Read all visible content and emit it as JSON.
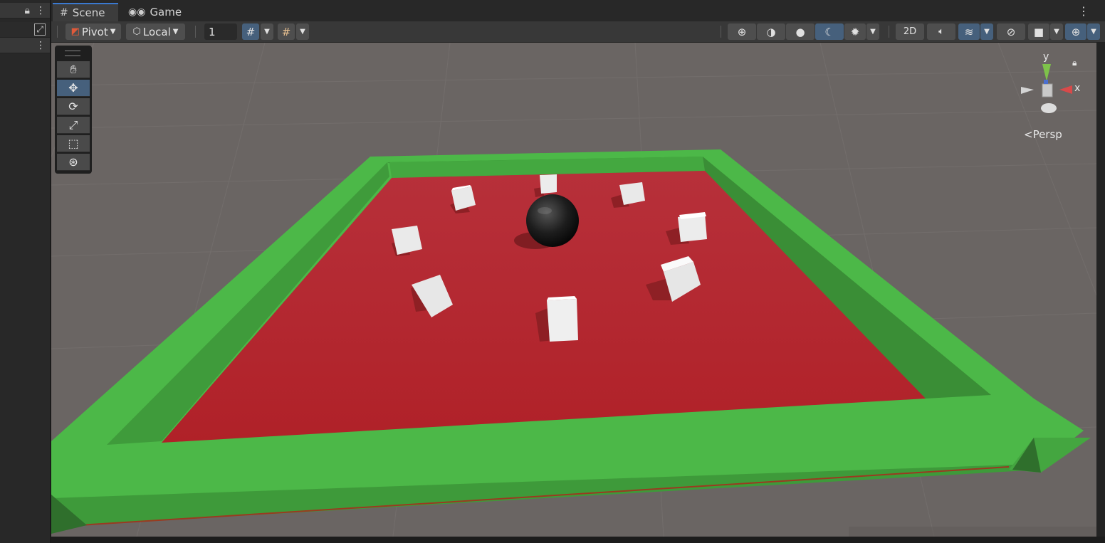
{
  "tabs": {
    "scene": {
      "label": "Scene",
      "icon": "grid-icon"
    },
    "game": {
      "label": "Game",
      "icon": "gamepad-icon"
    }
  },
  "toolbar": {
    "pivot_label": "Pivot",
    "local_label": "Local",
    "grid_size_value": "1",
    "mode_2d_label": "2D"
  },
  "view": {
    "projection_label": "<Persp",
    "axis_y": "y",
    "axis_x": "x"
  },
  "colors": {
    "arena_floor": "#b5282d",
    "arena_wall": "#4cb848",
    "ground": "#6a6563",
    "accent_blue": "#46607c"
  }
}
